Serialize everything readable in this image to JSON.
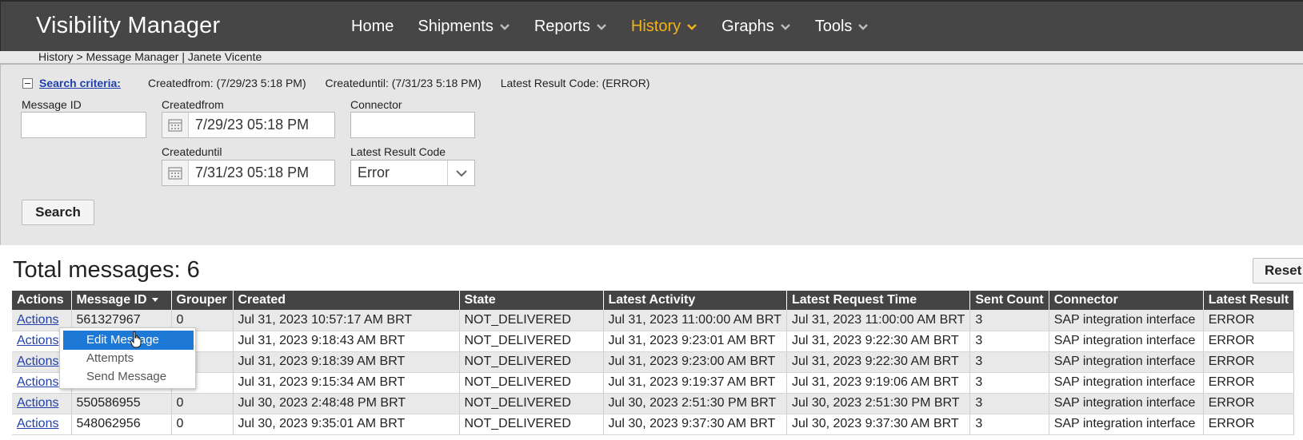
{
  "app": {
    "title": "Visibility Manager"
  },
  "nav": {
    "items": [
      {
        "label": "Home",
        "dropdown": false,
        "active": false
      },
      {
        "label": "Shipments",
        "dropdown": true,
        "active": false
      },
      {
        "label": "Reports",
        "dropdown": true,
        "active": false
      },
      {
        "label": "History",
        "dropdown": true,
        "active": true
      },
      {
        "label": "Graphs",
        "dropdown": true,
        "active": false
      },
      {
        "label": "Tools",
        "dropdown": true,
        "active": false
      }
    ],
    "active_color": "#f2b21b"
  },
  "breadcrumb": "History > Message Manager | Janete Vicente",
  "search": {
    "criteria_link": "Search criteria:",
    "summary": [
      "Createdfrom: (7/29/23 5:18 PM)",
      "Createduntil: (7/31/23 5:18 PM)",
      "Latest Result Code: (ERROR)"
    ],
    "fields": {
      "message_id": {
        "label": "Message ID",
        "value": ""
      },
      "created_from": {
        "label": "Createdfrom",
        "value": "7/29/23 05:18 PM"
      },
      "created_until": {
        "label": "Createduntil",
        "value": "7/31/23 05:18 PM"
      },
      "connector": {
        "label": "Connector",
        "value": ""
      },
      "latest_result_code": {
        "label": "Latest Result Code",
        "value": "Error"
      }
    },
    "search_button": "Search"
  },
  "results": {
    "total_label": "Total messages: 6",
    "reset_button": "Reset",
    "columns": [
      "Actions",
      "Message ID",
      "Grouper",
      "Created",
      "State",
      "Latest Activity",
      "Latest Request Time",
      "Sent Count",
      "Connector",
      "Latest Result"
    ],
    "rows": [
      [
        "Actions",
        "561327967",
        "0",
        "Jul 31, 2023 10:57:17 AM BRT",
        "NOT_DELIVERED",
        "Jul 31, 2023 11:00:00 AM BRT",
        "Jul 31, 2023 11:00:00 AM BRT",
        "3",
        "SAP integration interface",
        "ERROR"
      ],
      [
        "Actions",
        "",
        "",
        "Jul 31, 2023 9:18:43 AM BRT",
        "NOT_DELIVERED",
        "Jul 31, 2023 9:23:01 AM BRT",
        "Jul 31, 2023 9:22:30 AM BRT",
        "3",
        "SAP integration interface",
        "ERROR"
      ],
      [
        "Actions",
        "",
        "",
        "Jul 31, 2023 9:18:39 AM BRT",
        "NOT_DELIVERED",
        "Jul 31, 2023 9:23:00 AM BRT",
        "Jul 31, 2023 9:22:30 AM BRT",
        "3",
        "SAP integration interface",
        "ERROR"
      ],
      [
        "Actions",
        "",
        "",
        "Jul 31, 2023 9:15:34 AM BRT",
        "NOT_DELIVERED",
        "Jul 31, 2023 9:19:37 AM BRT",
        "Jul 31, 2023 9:19:06 AM BRT",
        "3",
        "SAP integration interface",
        "ERROR"
      ],
      [
        "Actions",
        "550586955",
        "0",
        "Jul 30, 2023 2:48:48 PM BRT",
        "NOT_DELIVERED",
        "Jul 30, 2023 2:51:30 PM BRT",
        "Jul 30, 2023 2:51:30 PM BRT",
        "3",
        "SAP integration interface",
        "ERROR"
      ],
      [
        "Actions",
        "548062956",
        "0",
        "Jul 30, 2023 9:35:01 AM BRT",
        "NOT_DELIVERED",
        "Jul 30, 2023 9:37:30 AM BRT",
        "Jul 30, 2023 9:37:30 AM BRT",
        "3",
        "SAP integration interface",
        "ERROR"
      ]
    ]
  },
  "context_menu": {
    "items": [
      "Edit Message",
      "Attempts",
      "Send Message"
    ],
    "highlight_color": "#1e78d6"
  }
}
